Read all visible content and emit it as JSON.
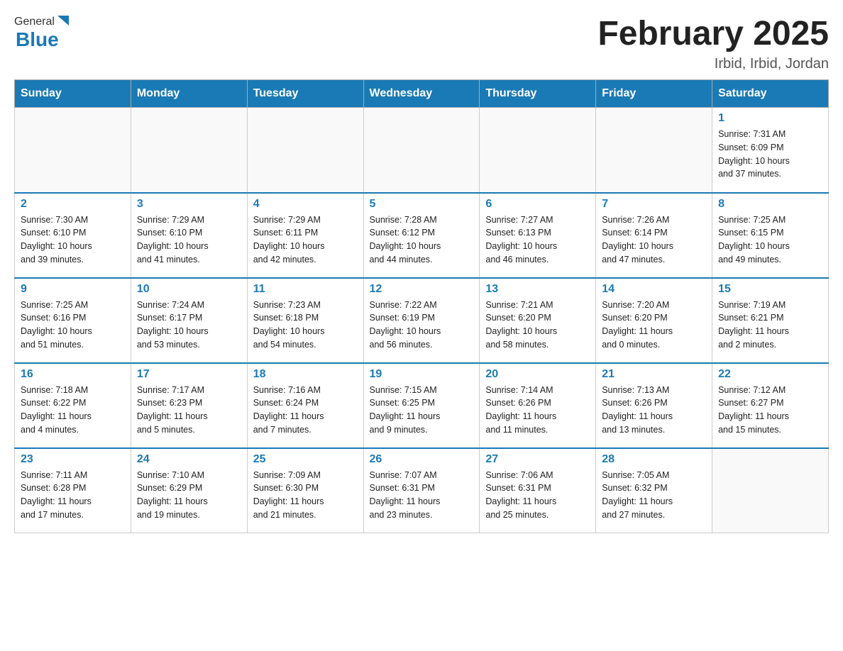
{
  "header": {
    "logo_general": "General",
    "logo_blue": "Blue",
    "title": "February 2025",
    "location": "Irbid, Irbid, Jordan"
  },
  "days_of_week": [
    "Sunday",
    "Monday",
    "Tuesday",
    "Wednesday",
    "Thursday",
    "Friday",
    "Saturday"
  ],
  "weeks": [
    [
      {
        "day": "",
        "info": ""
      },
      {
        "day": "",
        "info": ""
      },
      {
        "day": "",
        "info": ""
      },
      {
        "day": "",
        "info": ""
      },
      {
        "day": "",
        "info": ""
      },
      {
        "day": "",
        "info": ""
      },
      {
        "day": "1",
        "info": "Sunrise: 7:31 AM\nSunset: 6:09 PM\nDaylight: 10 hours\nand 37 minutes."
      }
    ],
    [
      {
        "day": "2",
        "info": "Sunrise: 7:30 AM\nSunset: 6:10 PM\nDaylight: 10 hours\nand 39 minutes."
      },
      {
        "day": "3",
        "info": "Sunrise: 7:29 AM\nSunset: 6:10 PM\nDaylight: 10 hours\nand 41 minutes."
      },
      {
        "day": "4",
        "info": "Sunrise: 7:29 AM\nSunset: 6:11 PM\nDaylight: 10 hours\nand 42 minutes."
      },
      {
        "day": "5",
        "info": "Sunrise: 7:28 AM\nSunset: 6:12 PM\nDaylight: 10 hours\nand 44 minutes."
      },
      {
        "day": "6",
        "info": "Sunrise: 7:27 AM\nSunset: 6:13 PM\nDaylight: 10 hours\nand 46 minutes."
      },
      {
        "day": "7",
        "info": "Sunrise: 7:26 AM\nSunset: 6:14 PM\nDaylight: 10 hours\nand 47 minutes."
      },
      {
        "day": "8",
        "info": "Sunrise: 7:25 AM\nSunset: 6:15 PM\nDaylight: 10 hours\nand 49 minutes."
      }
    ],
    [
      {
        "day": "9",
        "info": "Sunrise: 7:25 AM\nSunset: 6:16 PM\nDaylight: 10 hours\nand 51 minutes."
      },
      {
        "day": "10",
        "info": "Sunrise: 7:24 AM\nSunset: 6:17 PM\nDaylight: 10 hours\nand 53 minutes."
      },
      {
        "day": "11",
        "info": "Sunrise: 7:23 AM\nSunset: 6:18 PM\nDaylight: 10 hours\nand 54 minutes."
      },
      {
        "day": "12",
        "info": "Sunrise: 7:22 AM\nSunset: 6:19 PM\nDaylight: 10 hours\nand 56 minutes."
      },
      {
        "day": "13",
        "info": "Sunrise: 7:21 AM\nSunset: 6:20 PM\nDaylight: 10 hours\nand 58 minutes."
      },
      {
        "day": "14",
        "info": "Sunrise: 7:20 AM\nSunset: 6:20 PM\nDaylight: 11 hours\nand 0 minutes."
      },
      {
        "day": "15",
        "info": "Sunrise: 7:19 AM\nSunset: 6:21 PM\nDaylight: 11 hours\nand 2 minutes."
      }
    ],
    [
      {
        "day": "16",
        "info": "Sunrise: 7:18 AM\nSunset: 6:22 PM\nDaylight: 11 hours\nand 4 minutes."
      },
      {
        "day": "17",
        "info": "Sunrise: 7:17 AM\nSunset: 6:23 PM\nDaylight: 11 hours\nand 5 minutes."
      },
      {
        "day": "18",
        "info": "Sunrise: 7:16 AM\nSunset: 6:24 PM\nDaylight: 11 hours\nand 7 minutes."
      },
      {
        "day": "19",
        "info": "Sunrise: 7:15 AM\nSunset: 6:25 PM\nDaylight: 11 hours\nand 9 minutes."
      },
      {
        "day": "20",
        "info": "Sunrise: 7:14 AM\nSunset: 6:26 PM\nDaylight: 11 hours\nand 11 minutes."
      },
      {
        "day": "21",
        "info": "Sunrise: 7:13 AM\nSunset: 6:26 PM\nDaylight: 11 hours\nand 13 minutes."
      },
      {
        "day": "22",
        "info": "Sunrise: 7:12 AM\nSunset: 6:27 PM\nDaylight: 11 hours\nand 15 minutes."
      }
    ],
    [
      {
        "day": "23",
        "info": "Sunrise: 7:11 AM\nSunset: 6:28 PM\nDaylight: 11 hours\nand 17 minutes."
      },
      {
        "day": "24",
        "info": "Sunrise: 7:10 AM\nSunset: 6:29 PM\nDaylight: 11 hours\nand 19 minutes."
      },
      {
        "day": "25",
        "info": "Sunrise: 7:09 AM\nSunset: 6:30 PM\nDaylight: 11 hours\nand 21 minutes."
      },
      {
        "day": "26",
        "info": "Sunrise: 7:07 AM\nSunset: 6:31 PM\nDaylight: 11 hours\nand 23 minutes."
      },
      {
        "day": "27",
        "info": "Sunrise: 7:06 AM\nSunset: 6:31 PM\nDaylight: 11 hours\nand 25 minutes."
      },
      {
        "day": "28",
        "info": "Sunrise: 7:05 AM\nSunset: 6:32 PM\nDaylight: 11 hours\nand 27 minutes."
      },
      {
        "day": "",
        "info": ""
      }
    ]
  ],
  "colors": {
    "header_bg": "#1a7ab5",
    "accent_blue": "#1a7ab5"
  }
}
